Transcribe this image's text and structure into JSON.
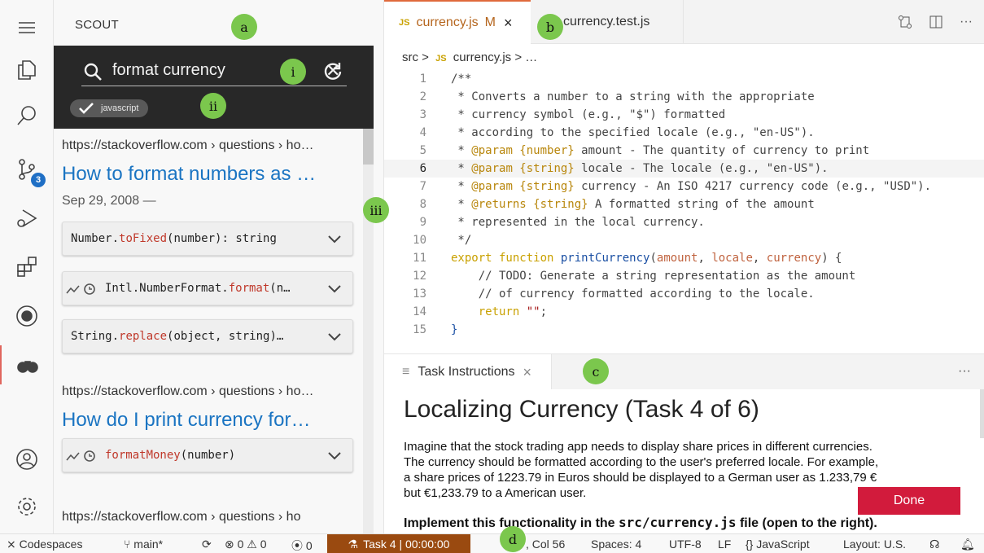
{
  "activity_bar": {
    "items": [
      "menu-icon",
      "explorer-icon",
      "search-icon",
      "source-control-icon",
      "run-debug-icon",
      "extensions-icon",
      "github-icon",
      "binoculars-icon",
      "account-icon",
      "settings-gear-icon"
    ],
    "source_control_badge": "3"
  },
  "sidebar": {
    "title": "SCOUT",
    "search": {
      "query": "format currency"
    },
    "filter_chip": "javascript",
    "results": [
      {
        "url": "https://stackoverflow.com › questions › ho…",
        "title": "How to format numbers as …",
        "date": "Sep 29, 2008 —",
        "snippets": [
          {
            "pre": "Number.",
            "red": "toFixed",
            "post": "(number): string"
          },
          {
            "pre": "Intl.NumberFormat.",
            "red": "format",
            "post": "(n…"
          },
          {
            "pre": "String.",
            "red": "replace",
            "post": "(object, string)…"
          }
        ]
      },
      {
        "url": "https://stackoverflow.com › questions › ho…",
        "title": "How do I print currency for…",
        "snippets": [
          {
            "pre": "",
            "red": "formatMoney",
            "post": "(number)"
          }
        ]
      }
    ],
    "cutoff_url": "https://stackoverflow.com › questions › ho"
  },
  "editor": {
    "tabs": [
      {
        "badge": "JS",
        "name": "currency.js",
        "status": "M",
        "close": "×"
      },
      {
        "name": "currency.test.js"
      }
    ],
    "tab_actions": [
      "compare-icon",
      "split-editor-icon",
      "more-icon"
    ],
    "breadcrumb": {
      "folder": "src",
      "sep": ">",
      "badge": "JS",
      "file": "currency.js",
      "tail": "> …"
    },
    "lines": [
      {
        "n": "1",
        "text": "/**"
      },
      {
        "n": "2",
        "text": " * Converts a number to a string with the appropriate"
      },
      {
        "n": "3",
        "text": " * currency symbol (e.g., \"$\") formatted"
      },
      {
        "n": "4",
        "text": " * according to the specified locale (e.g., \"en-US\")."
      },
      {
        "n": "5",
        "a": " * ",
        "tag": "@param",
        "type": " {number}",
        "b": " amount - The quantity of currency to print"
      },
      {
        "n": "6",
        "a": " * ",
        "tag": "@param",
        "type": " {string}",
        "b": " locale - The locale (e.g., \"en-US\")."
      },
      {
        "n": "7",
        "a": " * ",
        "tag": "@param",
        "type": " {string}",
        "b": " currency - An ISO 4217 currency code (e.g., \"USD\")."
      },
      {
        "n": "8",
        "a": " * ",
        "tag": "@returns",
        "type": " {string}",
        "b": " A formatted string of the amount"
      },
      {
        "n": "9",
        "text": " * represented in the local currency."
      },
      {
        "n": "10",
        "text": " */"
      },
      {
        "n": "11",
        "kw1": "export",
        "kw2": " function ",
        "fn": "printCurrency",
        "p0": "(",
        "pa": "amount",
        "c1": ", ",
        "pb": "locale",
        "c2": ", ",
        "pc": "currency",
        "p1": ") {"
      },
      {
        "n": "12",
        "text": "    // TODO: Generate a string representation as the amount"
      },
      {
        "n": "13",
        "text": "    // of currency formatted according to the locale."
      },
      {
        "n": "14",
        "kw": "    return ",
        "str": "\"\"",
        "end": ";"
      },
      {
        "n": "15",
        "text": "}"
      }
    ]
  },
  "panel": {
    "tab_label": "Task Instructions",
    "tab_close": "×",
    "more": "···",
    "heading": "Localizing Currency (Task 4 of 6)",
    "paragraph": [
      "Imagine that the stock trading app needs to display share prices in different currencies.",
      "The currency should be formatted according to the user's preferred locale. For example,",
      "a share prices of 1223.79 in Euros should be displayed to a German user as 1.233,79 €",
      "but €1,233.79 to a American user."
    ],
    "bold_pre": "Implement this functionality in the ",
    "bold_code": "src/currency.js",
    "bold_post": " file (open to the right).",
    "done_label": "Done"
  },
  "statusbar": {
    "codespaces": "Codespaces",
    "branch": "main*",
    "problems": "⊗ 0 ⚠ 0",
    "ports": "0",
    "task": "Task 4 | 00:00:00",
    "position": ", Col 56",
    "spaces": "Spaces: 4",
    "encoding": "UTF-8",
    "eol": "LF",
    "language": "{} JavaScript",
    "layout": "Layout: U.S."
  },
  "annotations": [
    "a",
    "b",
    "c",
    "d",
    "i",
    "ii",
    "iii"
  ]
}
